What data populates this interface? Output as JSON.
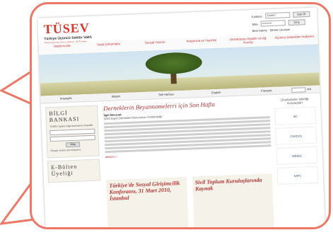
{
  "header": {
    "logo_mark": "TÜSEV",
    "logo_line1": "Türkiye Üçüncü Sektör Vakfı",
    "logo_line2": "Third Sector Foundation of Turkey"
  },
  "login": {
    "user_label": "Kullanıcı",
    "user_value": "Sistem",
    "pass_label": "Şifre",
    "pass_value": "••••••••••",
    "login_button": "Giriş",
    "remember_label": "Beni Hatırla",
    "forgot_label": "Şifremi Unuttum",
    "signup_button": "Üye Ol"
  },
  "nav": {
    "items": [
      {
        "label": "Hakkımızda"
      },
      {
        "label": "Yasal Çalışmalar"
      },
      {
        "label": "Sosyal Yatırım"
      },
      {
        "label": "Araştırma ve Yayınlar"
      },
      {
        "label": "Uluslararası İlişkiler ve Ağ Kurma"
      },
      {
        "label": "Üçüncü Sektörden Haberler"
      }
    ]
  },
  "subnav": {
    "items": [
      {
        "label": "Anasayfa"
      },
      {
        "label": "İletişim"
      },
      {
        "label": "Site Haritası"
      },
      {
        "label": "English"
      },
      {
        "label": "Français"
      }
    ],
    "search_button": "ara"
  },
  "bilgi": {
    "title": "BİLGİ BANKASI",
    "desc": "TÜSEV üyeleri bilgi bankasına erişebilir.",
    "button": "Giriş",
    "note": "Detaylı arama için tıklayınız"
  },
  "ebulten": {
    "title": "E-Bülten Üyeliği"
  },
  "main": {
    "title": "Derneklerin Beyannamelerri için Son Hafta",
    "meta": "İlgili Mevzuat:",
    "meta2": "5253 Sayılı Dernekler Kanununun Yönetmeliği",
    "more": "devamı »"
  },
  "tiles": [
    {
      "title": "Türkiye'de Sosyal Girişimcilik Konferansı, 31 Mart 2010, İstanbul"
    },
    {
      "title": "Sivil Toplum Kuruluşlarında Kaynak"
    }
  ],
  "right": {
    "head": "Uluslararası İşbirliği Kuruluşları",
    "partners": [
      {
        "name": "efc"
      },
      {
        "name": "CIVICUS"
      },
      {
        "name": "WINGS"
      },
      {
        "name": "KAFC"
      }
    ]
  }
}
